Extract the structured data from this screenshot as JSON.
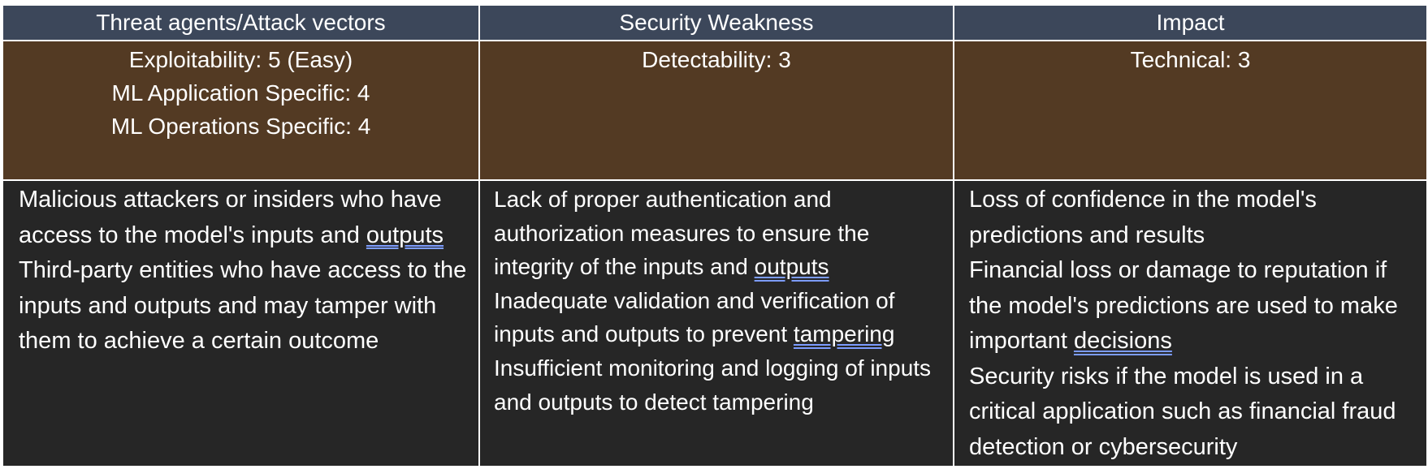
{
  "headers": [
    "Threat agents/Attack vectors",
    "Security Weakness",
    "Impact"
  ],
  "scores": {
    "col1": [
      "Exploitability: 5 (Easy)",
      "ML Application Specific: 4",
      "ML Operations Specific: 4"
    ],
    "col2": [
      "Detectability: 3"
    ],
    "col3": [
      "Technical: 3"
    ]
  },
  "descriptions": {
    "col1": {
      "p1_a": "Malicious attackers or insiders who have access to the model's inputs and ",
      "p1_b": "outputs",
      "p2": "Third-party entities who have access to the inputs and outputs and may tamper with them to achieve a certain outcome"
    },
    "col2": {
      "p1_a": "Lack of proper authentication and authorization measures to ensure the integrity of the inputs and ",
      "p1_b": "outputs",
      "p2_a": "Inadequate validation and verification of inputs and outputs to prevent ",
      "p2_b": "tampering",
      "p3": "Insufficient monitoring and logging of inputs and outputs to detect tampering"
    },
    "col3": {
      "p1": "Loss of confidence in the model's predictions and results",
      "p2_a": "Financial loss or damage to reputation if the model's predictions are used to make important ",
      "p2_b": "decisions",
      "p3": "Security risks if the model is used in a critical application such as financial fraud detection or cybersecurity"
    }
  },
  "colors": {
    "header_bg": "#3c475a",
    "score_bg": "#533a23",
    "desc_bg": "#262626",
    "text": "#ffffff",
    "spellcheck_underline": "#7c9cff"
  }
}
